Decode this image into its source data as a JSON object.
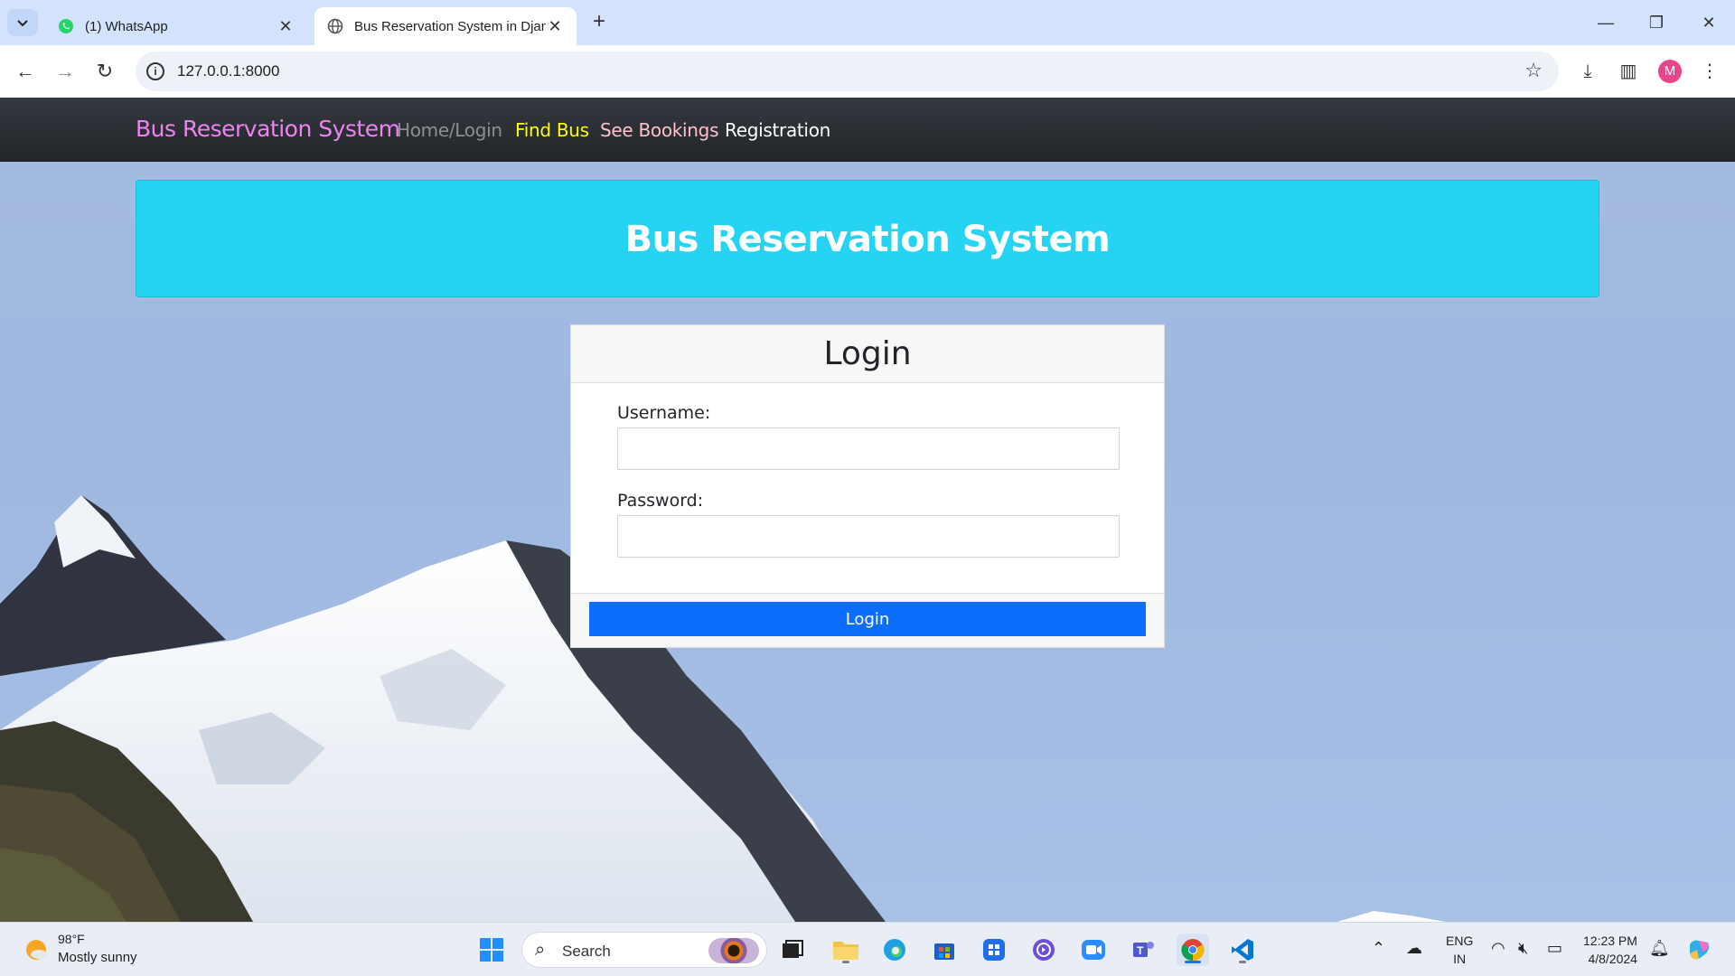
{
  "browser": {
    "tabs": [
      {
        "title": "(1) WhatsApp",
        "favicon": "whatsapp-icon",
        "active": false
      },
      {
        "title": "Bus Reservation System in Djan",
        "favicon": "globe-icon",
        "active": true
      }
    ],
    "url": "127.0.0.1:8000",
    "profile_initial": "M",
    "profile_color": "#e8458b"
  },
  "navbar": {
    "brand": "Bus Reservation System",
    "links": [
      {
        "label": "Home/Login",
        "color": "#8c8f93"
      },
      {
        "label": "Find Bus",
        "color": "#ffff00"
      },
      {
        "label": "See Bookings",
        "color": "#ffc0cb"
      },
      {
        "label": "Registration",
        "color": "#ffffff"
      }
    ],
    "brand_color": "#ee82ee"
  },
  "header": {
    "title": "Bus Reservation System",
    "background": "#25d3f3"
  },
  "login_card": {
    "title": "Login",
    "username_label": "Username:",
    "username_value": "",
    "password_label": "Password:",
    "password_value": "",
    "submit_label": "Login",
    "submit_color": "#0d6efd"
  },
  "taskbar": {
    "weather_temp": "98°F",
    "weather_desc": "Mostly sunny",
    "search_placeholder": "Search",
    "language_line1": "ENG",
    "language_line2": "IN",
    "time": "12:23 PM",
    "date": "4/8/2024"
  }
}
